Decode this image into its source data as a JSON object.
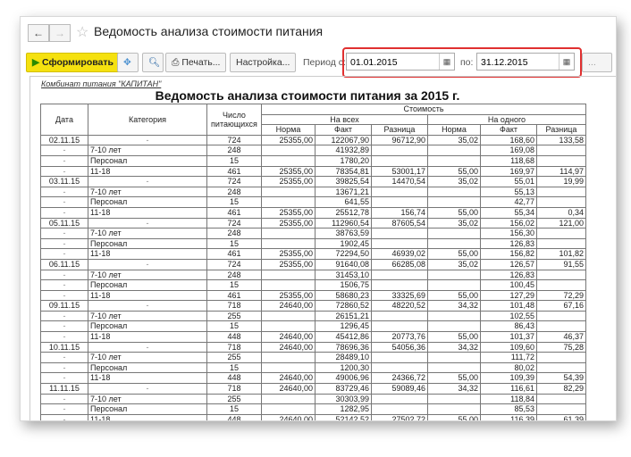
{
  "window": {
    "title": "Ведомость анализа стоимости питания",
    "back": "←",
    "forward": "→",
    "star": "☆"
  },
  "toolbar": {
    "generate": "Сформировать",
    "print": "Печать...",
    "settings": "Настройка...",
    "period_from_label": "Период с:",
    "period_from": "01.01.2015",
    "period_to_label": "по:",
    "period_to": "31.12.2015",
    "more": "..."
  },
  "report": {
    "org": "Комбинат питания \"КАПИТАН\"",
    "title": "Ведомость анализа стоимости питания за 2015 г.",
    "headers": {
      "date": "Дата",
      "category": "Категория",
      "count": "Число питающихся",
      "cost": "Стоимость",
      "all": "На всех",
      "one": "На одного",
      "norm": "Норма",
      "fact": "Факт",
      "diff": "Разница"
    },
    "rows": [
      [
        "02.11.15",
        "-",
        "724",
        "25355,00",
        "122067,90",
        "96712,90",
        "35,02",
        "168,60",
        "133,58"
      ],
      [
        "-",
        "7-10 лет",
        "248",
        "",
        "41932,89",
        "",
        "",
        "169,08",
        ""
      ],
      [
        "-",
        "Персонал",
        "15",
        "",
        "1780,20",
        "",
        "",
        "118,68",
        ""
      ],
      [
        "-",
        "11-18",
        "461",
        "25355,00",
        "78354,81",
        "53001,17",
        "55,00",
        "169,97",
        "114,97"
      ],
      [
        "03.11.15",
        "-",
        "724",
        "25355,00",
        "39825,54",
        "14470,54",
        "35,02",
        "55,01",
        "19,99"
      ],
      [
        "-",
        "7-10 лет",
        "248",
        "",
        "13671,21",
        "",
        "",
        "55,13",
        ""
      ],
      [
        "-",
        "Персонал",
        "15",
        "",
        "641,55",
        "",
        "",
        "42,77",
        ""
      ],
      [
        "-",
        "11-18",
        "461",
        "25355,00",
        "25512,78",
        "156,74",
        "55,00",
        "55,34",
        "0,34"
      ],
      [
        "05.11.15",
        "-",
        "724",
        "25355,00",
        "112960,54",
        "87605,54",
        "35,02",
        "156,02",
        "121,00"
      ],
      [
        "-",
        "7-10 лет",
        "248",
        "",
        "38763,59",
        "",
        "",
        "156,30",
        ""
      ],
      [
        "-",
        "Персонал",
        "15",
        "",
        "1902,45",
        "",
        "",
        "126,83",
        ""
      ],
      [
        "-",
        "11-18",
        "461",
        "25355,00",
        "72294,50",
        "46939,02",
        "55,00",
        "156,82",
        "101,82"
      ],
      [
        "06.11.15",
        "-",
        "724",
        "25355,00",
        "91640,08",
        "66285,08",
        "35,02",
        "126,57",
        "91,55"
      ],
      [
        "-",
        "7-10 лет",
        "248",
        "",
        "31453,10",
        "",
        "",
        "126,83",
        ""
      ],
      [
        "-",
        "Персонал",
        "15",
        "",
        "1506,75",
        "",
        "",
        "100,45",
        ""
      ],
      [
        "-",
        "11-18",
        "461",
        "25355,00",
        "58680,23",
        "33325,69",
        "55,00",
        "127,29",
        "72,29"
      ],
      [
        "09.11.15",
        "-",
        "718",
        "24640,00",
        "72860,52",
        "48220,52",
        "34,32",
        "101,48",
        "67,16"
      ],
      [
        "-",
        "7-10 лет",
        "255",
        "",
        "26151,21",
        "",
        "",
        "102,55",
        ""
      ],
      [
        "-",
        "Персонал",
        "15",
        "",
        "1296,45",
        "",
        "",
        "86,43",
        ""
      ],
      [
        "-",
        "11-18",
        "448",
        "24640,00",
        "45412,86",
        "20773,76",
        "55,00",
        "101,37",
        "46,37"
      ],
      [
        "10.11.15",
        "-",
        "718",
        "24640,00",
        "78696,36",
        "54056,36",
        "34,32",
        "109,60",
        "75,28"
      ],
      [
        "-",
        "7-10 лет",
        "255",
        "",
        "28489,10",
        "",
        "",
        "111,72",
        ""
      ],
      [
        "-",
        "Персонал",
        "15",
        "",
        "1200,30",
        "",
        "",
        "80,02",
        ""
      ],
      [
        "-",
        "11-18",
        "448",
        "24640,00",
        "49006,96",
        "24366,72",
        "55,00",
        "109,39",
        "54,39"
      ],
      [
        "11.11.15",
        "-",
        "718",
        "24640,00",
        "83729,46",
        "59089,46",
        "34,32",
        "116,61",
        "82,29"
      ],
      [
        "-",
        "7-10 лет",
        "255",
        "",
        "30303,99",
        "",
        "",
        "118,84",
        ""
      ],
      [
        "-",
        "Персонал",
        "15",
        "",
        "1282,95",
        "",
        "",
        "85,53",
        ""
      ],
      [
        "-",
        "11-18",
        "448",
        "24640,00",
        "52142,52",
        "27502,72",
        "55,00",
        "116,39",
        "61,39"
      ]
    ]
  }
}
